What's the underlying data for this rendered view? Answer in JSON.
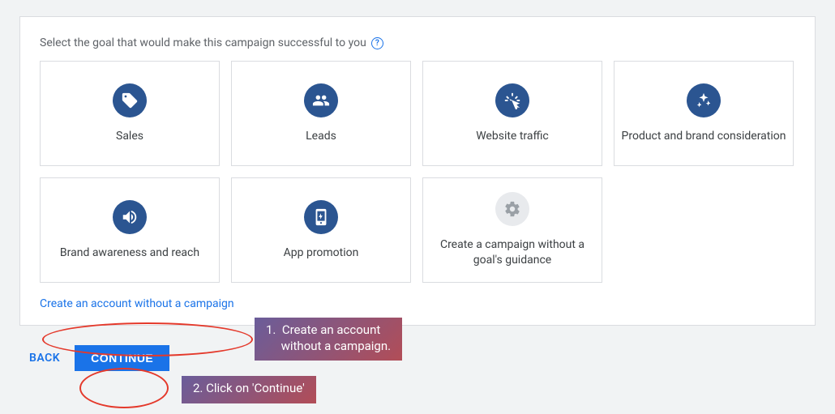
{
  "heading": "Select the goal that would make this campaign successful to you",
  "goals": [
    {
      "label": "Sales",
      "icon": "tag"
    },
    {
      "label": "Leads",
      "icon": "people"
    },
    {
      "label": "Website traffic",
      "icon": "click"
    },
    {
      "label": "Product and brand consideration",
      "icon": "sparkle"
    },
    {
      "label": "Brand awareness and reach",
      "icon": "megaphone"
    },
    {
      "label": "App promotion",
      "icon": "phone"
    },
    {
      "label": "Create a campaign without a goal's guidance",
      "icon": "gear",
      "grey": true
    }
  ],
  "link": "Create an account without a campaign",
  "back": "BACK",
  "continue": "CONTINUE",
  "annotations": {
    "step1": "1.  Create an account\n     without a campaign.",
    "step2": "2. Click on 'Continue'"
  }
}
